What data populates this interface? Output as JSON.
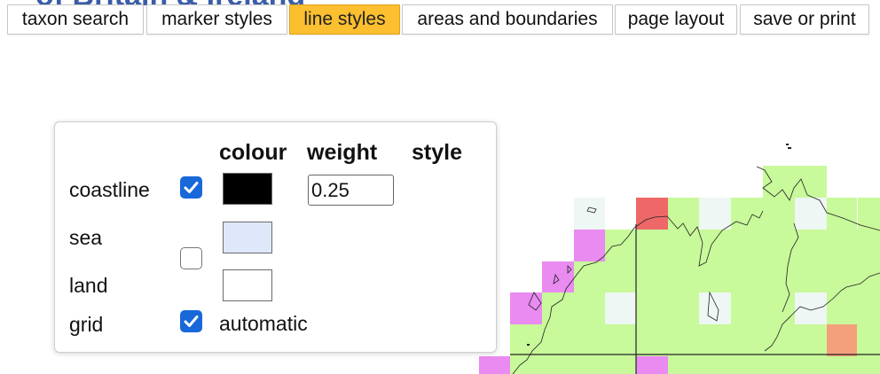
{
  "page": {
    "title_peek": "of Britain & Ireland"
  },
  "tabs": [
    {
      "label": "taxon search",
      "active": false
    },
    {
      "label": "marker styles",
      "active": false
    },
    {
      "label": "line styles",
      "active": true
    },
    {
      "label": "areas and boundaries",
      "active": false
    },
    {
      "label": "page layout",
      "active": false
    },
    {
      "label": "save or print",
      "active": false
    }
  ],
  "line_styles_panel": {
    "headers": {
      "colour": "colour",
      "weight": "weight",
      "style": "style"
    },
    "rows": {
      "coastline": {
        "label": "coastline",
        "checked": true,
        "colour": "#000000",
        "weight": "0.25"
      },
      "sea": {
        "label": "sea",
        "colour": "#dfe8fb"
      },
      "land": {
        "label": "land",
        "colour": "#ffffff"
      },
      "sea_land_checked": false,
      "grid": {
        "label": "grid",
        "checked": true,
        "mode": "automatic"
      }
    }
  },
  "map": {
    "colors": {
      "green": "#c8f99a",
      "magenta": "#e98bf0",
      "red": "#ee6868",
      "salmon": "#f4a07a",
      "pale": "#eef7f4"
    }
  }
}
